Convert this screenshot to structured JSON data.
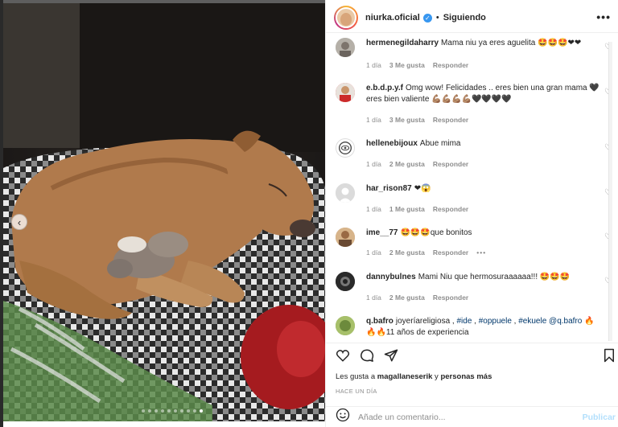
{
  "post": {
    "username": "niurka.oficial",
    "verified_icon": "verified-badge-icon",
    "follow_state": "Siguiendo",
    "carousel": {
      "total_slides": 10,
      "active_slide": 10
    }
  },
  "comments": [
    {
      "user": "hermenegildaharry",
      "text": "Mama niu ya eres aguelita 🤩🤩🤩❤❤",
      "time": "1 día",
      "likes": "3 Me gusta",
      "reply": "Responder"
    },
    {
      "user": "e.b.d.p.y.f",
      "text": "Omg wow! Felicidades .. eres bien una gran mama 🖤 eres bien valiente 💪🏽💪🏽💪🏽💪🏽🖤🖤🖤🖤",
      "time": "1 día",
      "likes": "3 Me gusta",
      "reply": "Responder"
    },
    {
      "user": "hellenebijoux",
      "text": "Abue mima",
      "time": "1 día",
      "likes": "2 Me gusta",
      "reply": "Responder"
    },
    {
      "user": "har_rison87",
      "text": "❤😱",
      "time": "1 día",
      "likes": "1 Me gusta",
      "reply": "Responder"
    },
    {
      "user": "ime__77",
      "text": "🤩🤩🤩que bonitos",
      "time": "1 día",
      "likes": "2 Me gusta",
      "reply": "Responder",
      "more": "•••"
    },
    {
      "user": "dannybulnes",
      "text": "Mami Niu que hermosuraaaaaa!!! 🤩🤩🤩",
      "time": "1 día",
      "likes": "2 Me gusta",
      "reply": "Responder"
    },
    {
      "user": "q.bafro",
      "text_prefix": "joyeríareligiosa , ",
      "tags": [
        "#ide",
        "#oppuele",
        "#ekuele",
        "@q.bafro"
      ],
      "text_suffix": " 🔥🔥🔥11 años de experiencia"
    }
  ],
  "footer": {
    "likes_prefix": "Les gusta a ",
    "likes_user": "magallaneserik",
    "likes_mid": " y ",
    "likes_others": "personas más",
    "time": "HACE UN DÍA",
    "add_comment_placeholder": "Añade un comentario...",
    "publish": "Publicar"
  },
  "colors": {
    "accent_blue": "#3897f0",
    "publish_disabled": "#b2dffc",
    "meta_gray": "#8e8e8e",
    "text": "#262626",
    "like_red": "#ed4956"
  },
  "icons": [
    "heart-icon",
    "comment-icon",
    "share-icon",
    "save-icon",
    "emoji-icon",
    "more-options-icon",
    "chevron-left-icon"
  ]
}
